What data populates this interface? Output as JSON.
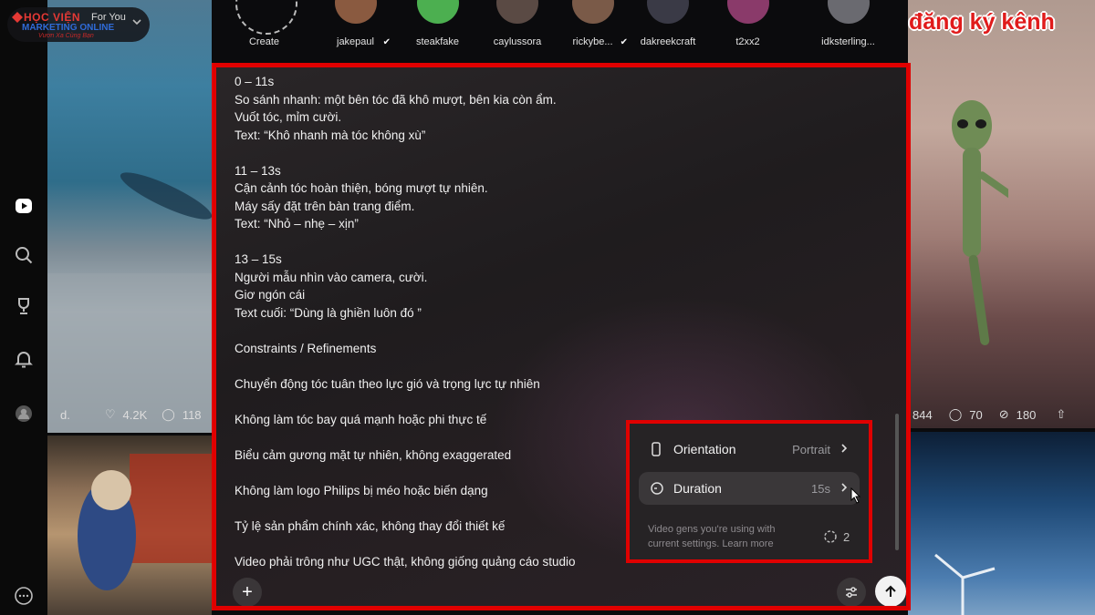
{
  "logo": {
    "line1": "HỌC VIỆN",
    "line2": "MARKETING ONLINE",
    "tagline": "Vươn Xa Cùng Bạn",
    "feed_label": "For You"
  },
  "subscribe_overlay": "đăng ký kênh",
  "creators": [
    {
      "name": "Create",
      "color": "#2a2a2a"
    },
    {
      "name": "jakepaul",
      "color": "#8a5a40",
      "verified": true
    },
    {
      "name": "steakfake",
      "color": "#4caf50"
    },
    {
      "name": "caylussora",
      "color": "#5a4a44"
    },
    {
      "name": "rickybe...",
      "color": "#7a5a48",
      "verified": true
    },
    {
      "name": "dakreekcraft",
      "color": "#3a3a46"
    },
    {
      "name": "t2xx2",
      "color": "#8a3a6a"
    },
    {
      "name": "idksterling...",
      "color": "#6a6a70"
    }
  ],
  "left_stats": {
    "author": "d.",
    "likes": "4.2K",
    "comments": "118"
  },
  "right_stats": {
    "views": "844",
    "comments": "70",
    "remixes": "180"
  },
  "prompt_lines": [
    "0 – 11s",
    "So sánh nhanh: một bên tóc đã khô mượt, bên kia còn ẩm.",
    "Vuốt tóc, mỉm cười.",
    "Text: “Khô nhanh mà tóc không xù”",
    "",
    "11 – 13s",
    "Cận cảnh tóc hoàn thiện, bóng mượt tự nhiên.",
    "Máy sấy đặt trên bàn trang điểm.",
    "Text: “Nhỏ – nhẹ – xịn”",
    "",
    "13 – 15s",
    "Người mẫu nhìn vào camera, cười.",
    "Giơ ngón cái",
    "Text cuối: “Dùng là ghiền luôn đó     ”",
    "",
    "Constraints / Refinements",
    "",
    "Chuyển động tóc tuân theo lực gió và trọng lực tự nhiên",
    "",
    "Không làm tóc bay quá mạnh hoặc phi thực tế",
    "",
    "Biểu cảm gương mặt tự nhiên, không exaggerated",
    "",
    "Không làm logo Philips bị méo hoặc biến dạng",
    "",
    "Tỷ lệ sản phẩm chính xác, không thay đổi thiết kế",
    "",
    "Video phải trông như UGC thật, không giống quảng cáo studio"
  ],
  "settings": {
    "orientation": {
      "label": "Orientation",
      "value": "Portrait"
    },
    "duration": {
      "label": "Duration",
      "value": "15s"
    },
    "note": "Video gens you're using with current settings. Learn more",
    "gens_count": "2"
  },
  "composer": {
    "add_label": "+"
  }
}
